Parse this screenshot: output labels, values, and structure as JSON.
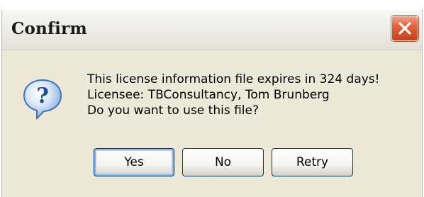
{
  "window": {
    "title": "Confirm"
  },
  "message": {
    "line1": "This license information file expires in 324 days!",
    "line2": "Licensee: TBConsultancy, Tom Brunberg",
    "line3": "Do you want to use this file?"
  },
  "buttons": {
    "yes_label": "Yes",
    "no_label": "No",
    "retry_label": "Retry"
  },
  "icons": {
    "dialog_icon": "question-icon",
    "close_icon": "close-icon"
  },
  "colors": {
    "close_button": "#e2633e",
    "question_icon": "#2b6fc7",
    "default_button_focus": "#8db2e3"
  }
}
